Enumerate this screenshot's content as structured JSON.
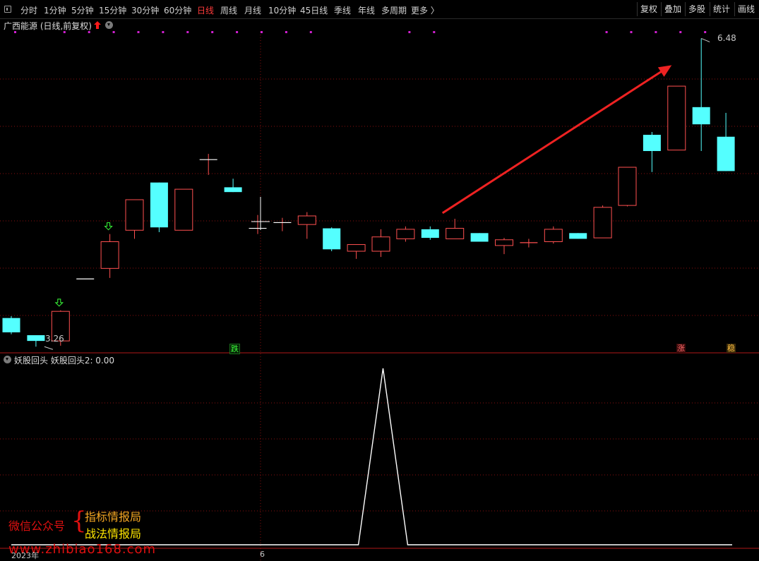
{
  "toolbar": {
    "periods": [
      "分时",
      "1分钟",
      "5分钟",
      "15分钟",
      "30分钟",
      "60分钟",
      "日线",
      "周线",
      "月线",
      "10分钟",
      "45日线",
      "季线",
      "年线",
      "多周期",
      "更多 〉"
    ],
    "active_period": "日线",
    "tools": [
      "复权",
      "叠加",
      "多股",
      "统计",
      "画线"
    ]
  },
  "main_panel": {
    "title": "广西能源 (日线,前复权)",
    "high_label": "6.48",
    "low_label": "3.26",
    "badges": {
      "fall": "跌",
      "rise": "涨",
      "stable": "稳"
    }
  },
  "sub_panel": {
    "title": "妖股回头  妖股回头2: 0.00"
  },
  "watermark": {
    "left": "微信公众号",
    "brace": "{",
    "right1": "指标情报局",
    "right2": "战法情报局",
    "url": "www.zhibiao168.com"
  },
  "dates": {
    "start": "2023年",
    "mark": "6"
  },
  "colors": {
    "up": "#ff5050",
    "down": "#54ffff",
    "grid": "#8a1010",
    "arrow": "#ee2222",
    "signal": "#ffffff",
    "dot": "#d020d0"
  },
  "chart_data": {
    "type": "candlestick",
    "price_range": [
      3.2,
      6.55
    ],
    "candles": [
      {
        "o": 3.55,
        "h": 3.57,
        "l": 3.38,
        "c": 3.4
      },
      {
        "o": 3.37,
        "h": 3.37,
        "l": 3.25,
        "c": 3.31
      },
      {
        "o": 3.31,
        "h": 3.63,
        "l": 3.26,
        "c": 3.62
      },
      {
        "o": 3.96,
        "h": 3.96,
        "l": 3.96,
        "c": 3.96
      },
      {
        "o": 4.07,
        "h": 4.43,
        "l": 3.97,
        "c": 4.35
      },
      {
        "o": 4.47,
        "h": 4.79,
        "l": 4.38,
        "c": 4.79
      },
      {
        "o": 4.97,
        "h": 4.97,
        "l": 4.45,
        "c": 4.5
      },
      {
        "o": 4.47,
        "h": 4.9,
        "l": 4.47,
        "c": 4.9
      },
      {
        "o": 5.21,
        "h": 5.27,
        "l": 5.05,
        "c": 5.21
      },
      {
        "o": 4.92,
        "h": 5.01,
        "l": 4.87,
        "c": 4.87
      },
      {
        "o": 4.49,
        "h": 4.63,
        "l": 4.43,
        "c": 4.49
      },
      {
        "o": 4.55,
        "h": 4.6,
        "l": 4.46,
        "c": 4.55
      },
      {
        "o": 4.53,
        "h": 4.66,
        "l": 4.38,
        "c": 4.62
      },
      {
        "o": 4.49,
        "h": 4.5,
        "l": 4.25,
        "c": 4.27
      },
      {
        "o": 4.25,
        "h": 4.31,
        "l": 4.17,
        "c": 4.32
      },
      {
        "o": 4.25,
        "h": 4.48,
        "l": 4.19,
        "c": 4.4
      },
      {
        "o": 4.38,
        "h": 4.51,
        "l": 4.35,
        "c": 4.48
      },
      {
        "o": 4.48,
        "h": 4.51,
        "l": 4.37,
        "c": 4.39
      },
      {
        "o": 4.38,
        "h": 4.59,
        "l": 4.38,
        "c": 4.49
      },
      {
        "o": 4.44,
        "h": 4.44,
        "l": 4.35,
        "c": 4.35
      },
      {
        "o": 4.31,
        "h": 4.39,
        "l": 4.22,
        "c": 4.37
      },
      {
        "o": 4.33,
        "h": 4.38,
        "l": 4.29,
        "c": 4.34
      },
      {
        "o": 4.35,
        "h": 4.51,
        "l": 4.33,
        "c": 4.48
      },
      {
        "o": 4.44,
        "h": 4.44,
        "l": 4.38,
        "c": 4.38
      },
      {
        "o": 4.39,
        "h": 4.73,
        "l": 4.39,
        "c": 4.71
      },
      {
        "o": 4.73,
        "h": 5.13,
        "l": 4.72,
        "c": 5.13
      },
      {
        "o": 5.47,
        "h": 5.5,
        "l": 5.08,
        "c": 5.3
      },
      {
        "o": 5.31,
        "h": 5.98,
        "l": 5.31,
        "c": 5.98
      },
      {
        "o": 5.76,
        "h": 6.48,
        "l": 5.3,
        "c": 5.58
      },
      {
        "o": 5.45,
        "h": 5.7,
        "l": 5.09,
        "c": 5.09
      }
    ],
    "signal_series": [
      0,
      0,
      0,
      0,
      0,
      0,
      0,
      0,
      0,
      0,
      0,
      0,
      0,
      0,
      0,
      1,
      0,
      0,
      0,
      0,
      0,
      0,
      0,
      0,
      0,
      0,
      0,
      0,
      0,
      0
    ],
    "dot_markers": [
      0,
      2,
      3,
      4,
      5,
      6,
      7,
      8,
      9,
      10,
      11,
      12,
      16,
      17,
      24,
      25,
      26,
      27,
      28
    ],
    "down_arrow_markers": [
      2,
      4
    ],
    "up_arrow_markers": [],
    "trend_arrow": {
      "from": [
        17.5,
        4.65
      ],
      "to": [
        26.8,
        6.2
      ]
    }
  }
}
